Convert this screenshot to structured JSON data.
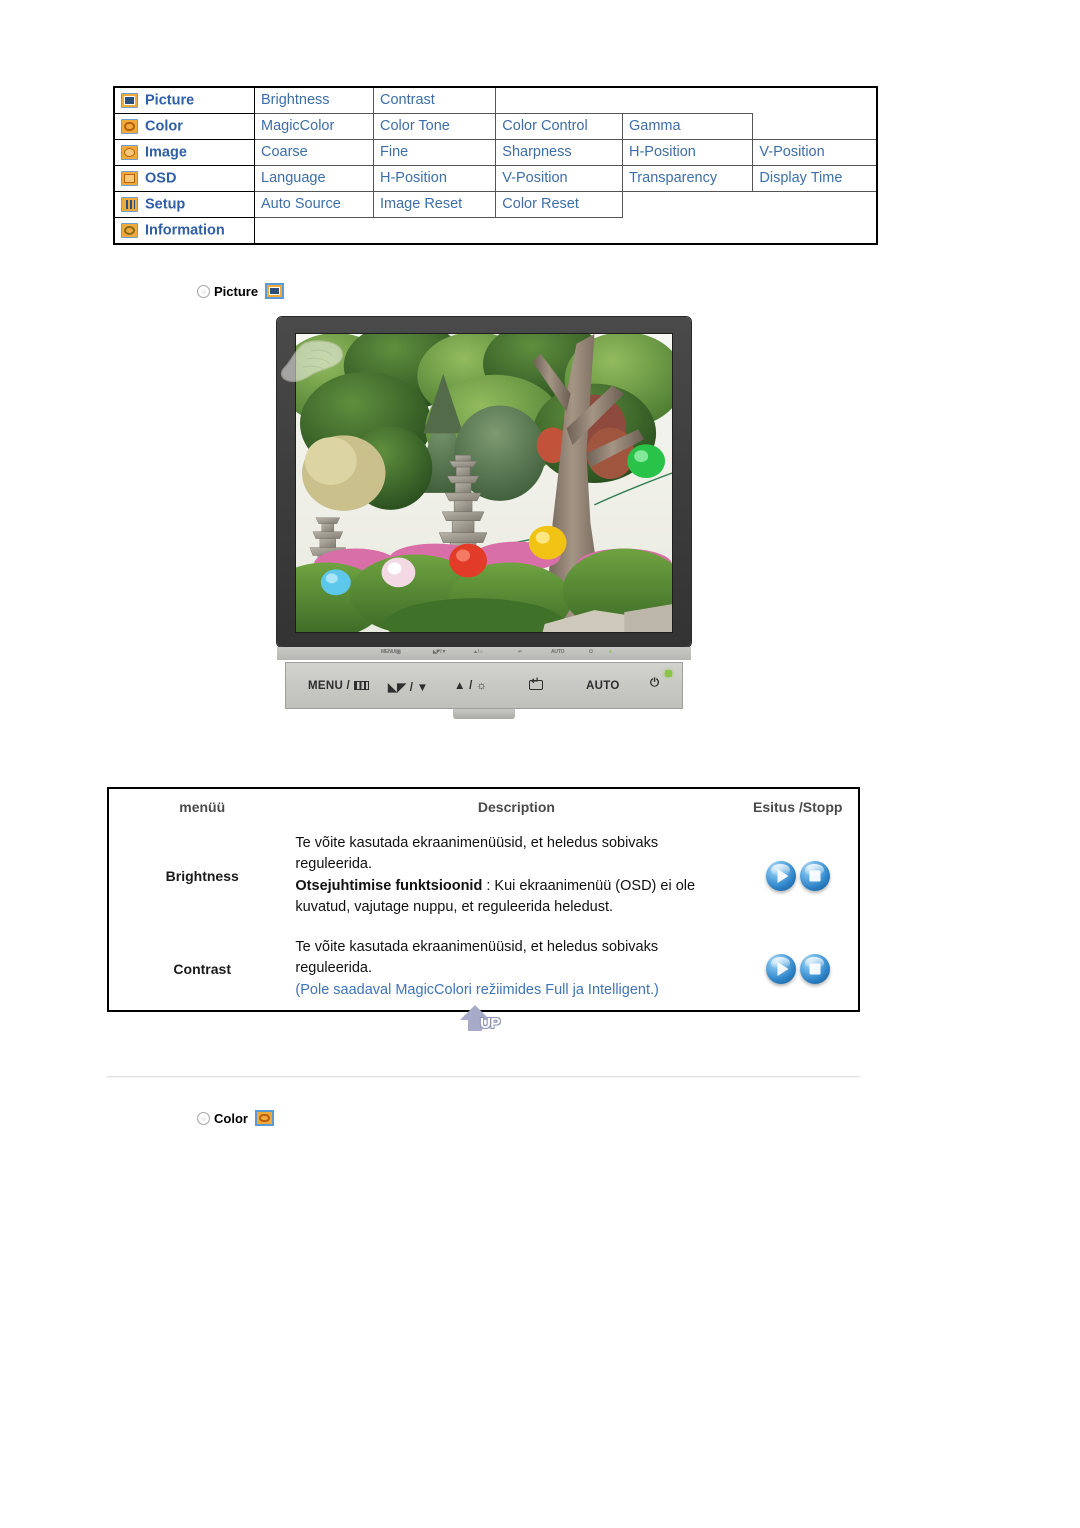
{
  "menu_map": {
    "rows": [
      {
        "icon": "picture-icon",
        "category": "Picture",
        "items": [
          "Brightness",
          "Contrast"
        ]
      },
      {
        "icon": "color-icon",
        "category": "Color",
        "items": [
          "MagicColor",
          "Color Tone",
          "Color Control",
          "Gamma"
        ]
      },
      {
        "icon": "image-icon",
        "category": "Image",
        "items": [
          "Coarse",
          "Fine",
          "Sharpness",
          "H-Position",
          "V-Position"
        ]
      },
      {
        "icon": "osd-icon",
        "category": "OSD",
        "items": [
          "Language",
          "H-Position",
          "V-Position",
          "Transparency",
          "Display Time"
        ]
      },
      {
        "icon": "setup-icon",
        "category": "Setup",
        "items": [
          "Auto Source",
          "Image Reset",
          "Color Reset"
        ]
      },
      {
        "icon": "information-icon",
        "category": "Information",
        "items": []
      }
    ]
  },
  "section_picture": {
    "label": "Picture",
    "icon": "picture-chip-icon"
  },
  "section_color": {
    "label": "Color",
    "icon": "color-chip-icon"
  },
  "monitor": {
    "bezel_strip_labels": [
      "MENU / ☰",
      "◁▷ / ▼",
      "▲ / ☀",
      "↵",
      "AUTO",
      "⏻"
    ],
    "buttons": [
      {
        "name": "menu-button",
        "label": "MENU /",
        "glyph": "bars"
      },
      {
        "name": "down-button",
        "label": "/ ▼",
        "glyph": "magic"
      },
      {
        "name": "up-brightness-button",
        "label": "▲ / ☼",
        "glyph": ""
      },
      {
        "name": "enter-button",
        "label": "",
        "glyph": "enter"
      },
      {
        "name": "auto-button",
        "label": "AUTO",
        "glyph": ""
      },
      {
        "name": "power-button",
        "label": "⏻",
        "glyph": "power"
      }
    ],
    "power_led_color": "#8bc34a"
  },
  "desc_table": {
    "headers": [
      "menüü",
      "Description",
      "Esitus /Stopp"
    ],
    "rows": [
      {
        "menu": "Brightness",
        "lines": [
          {
            "text": "Te võite kasutada ekraanimenüüsid, et heledus sobivaks reguleerida.",
            "style": "normal"
          },
          {
            "bold": "Otsejuhtimise funktsioonid",
            "text": " : Kui ekraanimenüü (OSD) ei ole kuvatud, vajutage nuppu, et reguleerida heledust.",
            "style": "mixed"
          }
        ],
        "controls": [
          "play-button",
          "stop-button"
        ]
      },
      {
        "menu": "Contrast",
        "lines": [
          {
            "text": "Te võite kasutada ekraanimenüüsid, et heledus sobivaks reguleerida.",
            "style": "normal"
          },
          {
            "text": "(Pole saadaval MagicColori režiimides Full ja Intelligent.)",
            "style": "blue"
          }
        ],
        "controls": [
          "play-button",
          "stop-button"
        ]
      }
    ]
  },
  "up_button": {
    "label": "UP",
    "icon": "up-arrow-icon"
  },
  "colors": {
    "menu_category_text": "#2f5fa8",
    "menu_item_text": "#3d6ea8",
    "note_blue": "#3f74b8",
    "header_gray": "#4a4a4a",
    "icon_orange": "#f0a93b",
    "icon_border_blue": "#5b9bd5",
    "orb_blue": "#2e84c8",
    "up_arrow": "#a7abc9"
  }
}
